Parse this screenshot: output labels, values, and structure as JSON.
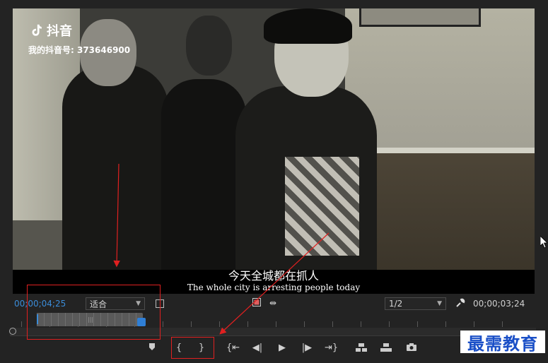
{
  "video": {
    "watermark": {
      "brand": "抖音",
      "account": "我的抖音号: 373646900",
      "icon": "tiktok-note-icon"
    },
    "subtitle_zh": "今天全城都在抓人",
    "subtitle_en": "The whole city is arresting people today"
  },
  "controls": {
    "timecode_current": "00;00;04;25",
    "zoom_select": "适合",
    "resolution_select": "1/2",
    "timecode_duration": "00;00;03;24",
    "icons": {
      "settings": "wrench-icon",
      "export_frame": "camera-icon",
      "safe_margins": "safe-margins-icon",
      "marker": "marker-icon",
      "mark_in": "mark-in-icon",
      "mark_out": "mark-out-icon",
      "go_to_in": "go-to-in-icon",
      "step_back": "step-back-icon",
      "play": "play-icon",
      "step_forward": "step-forward-icon",
      "go_to_out": "go-to-out-icon",
      "insert": "insert-icon",
      "overwrite": "overwrite-icon"
    },
    "labels": {
      "mark_in": "{",
      "mark_out": "}"
    }
  },
  "logo": {
    "text": "最需教育"
  },
  "colors": {
    "timecode_blue": "#3b8cd8",
    "annotation_red": "#e02020",
    "logo_blue": "#1a4fc7"
  }
}
